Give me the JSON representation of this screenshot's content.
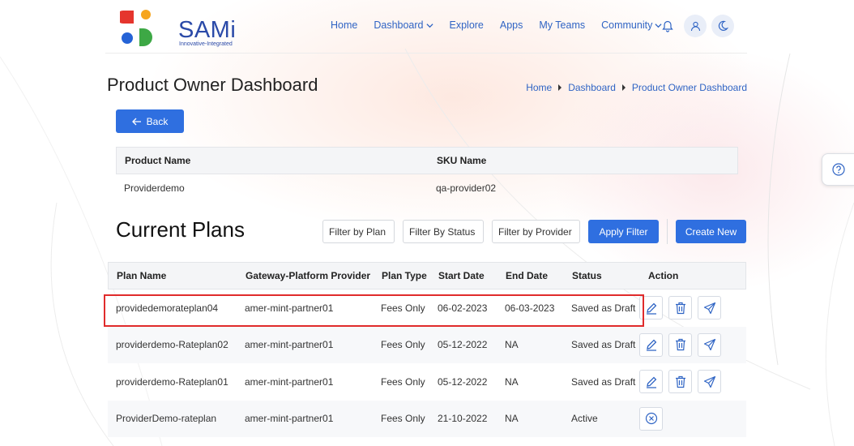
{
  "brand": {
    "name": "SAMi",
    "tagline": "Innovative-Integrated"
  },
  "nav": [
    {
      "label": "Home"
    },
    {
      "label": "Dashboard"
    },
    {
      "label": "Explore"
    },
    {
      "label": "Apps"
    },
    {
      "label": "My Teams"
    },
    {
      "label": "Community"
    }
  ],
  "page": {
    "title": "Product Owner Dashboard",
    "back_label": "Back"
  },
  "breadcrumb": [
    "Home",
    "Dashboard",
    "Product Owner Dashboard"
  ],
  "product_table": {
    "headers": [
      "Product Name",
      "SKU Name"
    ],
    "rows": [
      [
        "Providerdemo",
        "qa-provider02"
      ]
    ]
  },
  "plans": {
    "title": "Current Plans",
    "filters": [
      "Filter by Plan",
      "Filter By Status",
      "Filter by Provider"
    ],
    "apply_label": "Apply Filter",
    "create_label": "Create New",
    "headers": [
      "Plan Name",
      "Gateway-Platform Provider",
      "Plan Type",
      "Start Date",
      "End Date",
      "Status",
      "Action"
    ],
    "rows": [
      {
        "name": "providedemorateplan04",
        "provider": "amer-mint-partner01",
        "type": "Fees Only",
        "start": "06-02-2023",
        "end": "06-03-2023",
        "status": "Saved as Draft"
      },
      {
        "name": "providerdemo-Rateplan02",
        "provider": "amer-mint-partner01",
        "type": "Fees Only",
        "start": "05-12-2022",
        "end": "NA",
        "status": "Saved as Draft"
      },
      {
        "name": "providerdemo-Rateplan01",
        "provider": "amer-mint-partner01",
        "type": "Fees Only",
        "start": "05-12-2022",
        "end": "NA",
        "status": "Saved as Draft"
      },
      {
        "name": "ProviderDemo-rateplan",
        "provider": "amer-mint-partner01",
        "type": "Fees Only",
        "start": "21-10-2022",
        "end": "NA",
        "status": "Active"
      }
    ]
  },
  "colors": {
    "primary": "#2f6fe0",
    "link": "#2f64c4",
    "highlight": "#e02b2b",
    "brand_blue": "#2b4aa8"
  },
  "icons": {
    "actions": [
      "edit-icon",
      "delete-icon",
      "send-icon",
      "cancel-icon"
    ],
    "header": [
      "bell-icon",
      "user-icon",
      "moon-icon"
    ],
    "help": "help-icon"
  }
}
